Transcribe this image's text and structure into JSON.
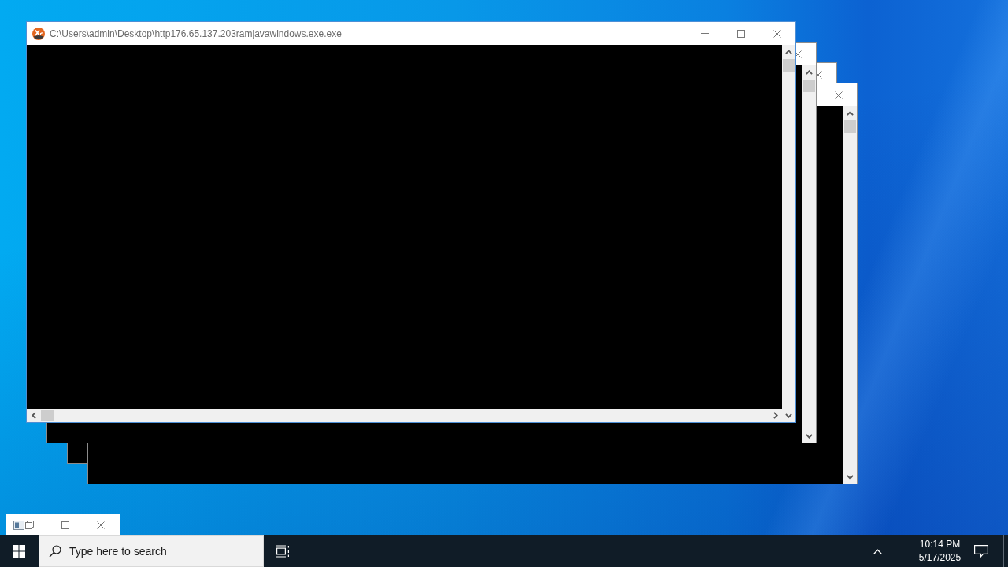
{
  "windows": [
    {
      "kind": "console",
      "title": "C:\\Users\\admin\\Desktop\\http176.65.137.203ramjavawindows.exe.exe"
    },
    {
      "kind": "console"
    },
    {
      "kind": "console"
    },
    {
      "kind": "console"
    },
    {
      "kind": "minimized"
    }
  ],
  "taskbar": {
    "search": {
      "placeholder": "Type here to search"
    },
    "clock": {
      "time": "10:14 PM",
      "date": "5/17/2025"
    }
  }
}
